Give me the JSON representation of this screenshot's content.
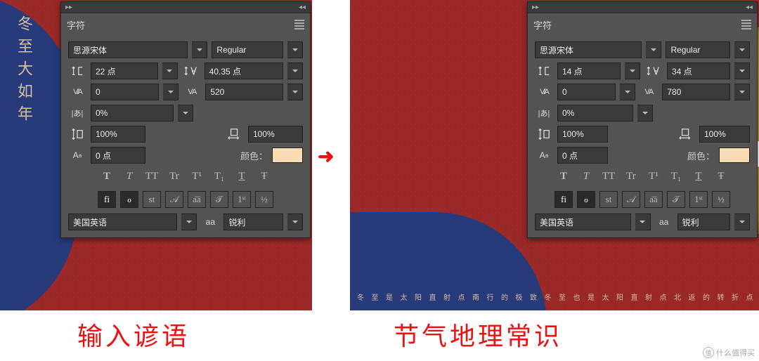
{
  "left": {
    "artwork_text": "冬至大如年",
    "panel": {
      "tab": "字符",
      "font_family": "思源宋体",
      "font_style": "Regular",
      "font_size": "22 点",
      "leading": "40.35 点",
      "kerning": "0",
      "tracking": "520",
      "tsume": "0%",
      "v_scale": "100%",
      "h_scale": "100%",
      "baseline": "0 点",
      "color_label": "颜色：",
      "color_value": "#f8dcb4",
      "language": "美国英语",
      "antialias": "锐利"
    }
  },
  "right": {
    "artwork_bottom": "冬 至 是 太 阳 直 射 点 南 行 的 极 致    冬 至 也 是 太 阳 直 射 点 北 返 的 转 折 点",
    "panel": {
      "tab": "字符",
      "font_family": "思源宋体",
      "font_style": "Regular",
      "font_size": "14 点",
      "leading": "34 点",
      "kerning": "0",
      "tracking": "780",
      "tsume": "0%",
      "v_scale": "100%",
      "h_scale": "100%",
      "baseline": "0 点",
      "color_label": "颜色：",
      "color_value": "#f8dcb4",
      "language": "美国英语",
      "antialias": "锐利"
    }
  },
  "type_styles": [
    "T",
    "T",
    "TT",
    "Tr",
    "T¹",
    "T₁",
    "T",
    "Ŧ"
  ],
  "ot_features": [
    "fi",
    "ℴ",
    "st",
    "𝒜",
    "a͞a",
    "𝒯",
    "1ˢᵗ",
    "½"
  ],
  "antialias_icon": "aa",
  "captions": {
    "left": "输入谚语",
    "right": "节气地理常识"
  },
  "arrow": "➜",
  "watermark": {
    "icon": "值",
    "text": "什么值得买"
  }
}
